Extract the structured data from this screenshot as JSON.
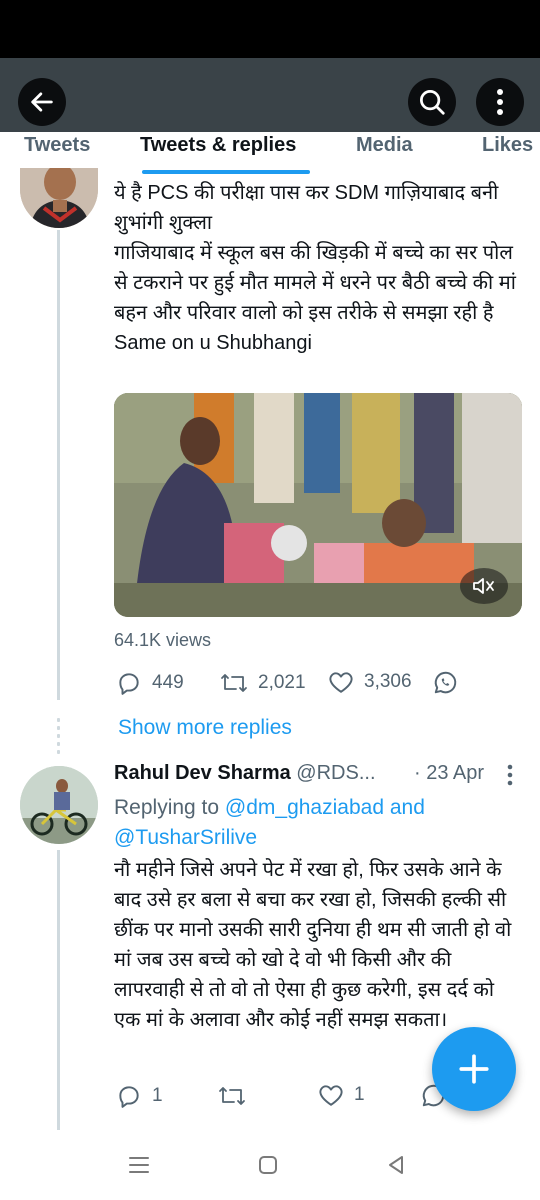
{
  "tabs": [
    "Tweets",
    "Tweets & replies",
    "Media",
    "Likes"
  ],
  "tweet1": {
    "text": "ये है PCS की परीक्षा पास कर SDM गाज़ियाबाद बनी शुभांगी शुक्ला\nगाजियाबाद में स्कूल बस की खिड़की में बच्चे का सर पोल से टकराने पर हुई मौत मामले में धरने पर बैठी बच्चे की मां बहन और परिवार वालो को इस तरीके से समझा रही है\nSame on u Shubhangi",
    "views": "64.1K views",
    "replies": "449",
    "retweets": "2,021",
    "likes": "3,306"
  },
  "show_more": "Show more replies",
  "tweet2": {
    "name": "Rahul Dev Sharma",
    "handle": "@RDS...",
    "date": "· 23 Apr",
    "replying_prefix": "Replying to ",
    "mention1": "@dm_ghaziabad",
    "and": " and",
    "mention2": "@TusharSrilive",
    "text": "नौ महीने जिसे अपने पेट में रखा हो, फिर उसके आने के बाद उसे हर बला से बचा कर रखा हो, जिसकी हल्की सी छींक पर मानो उसकी सारी दुनिया ही थम सी जाती हो वो मां जब उस बच्चे को खो दे वो भी किसी और की लापरवाही से तो वो तो ऐसा ही कुछ करेगी, इस दर्द को एक मां के अलावा और कोई नहीं समझ सकता।",
    "replies": "1",
    "likes": "1"
  },
  "icons": {
    "back": "arrow-left-icon",
    "search": "search-icon",
    "more": "more-vertical-icon",
    "reply": "reply-icon",
    "retweet": "retweet-icon",
    "like": "heart-icon",
    "share": "whatsapp-icon",
    "mute": "mute-icon",
    "compose": "plus-icon"
  },
  "colors": {
    "accent": "#1d9bf0",
    "header": "#3a4348",
    "muted": "#536471"
  }
}
